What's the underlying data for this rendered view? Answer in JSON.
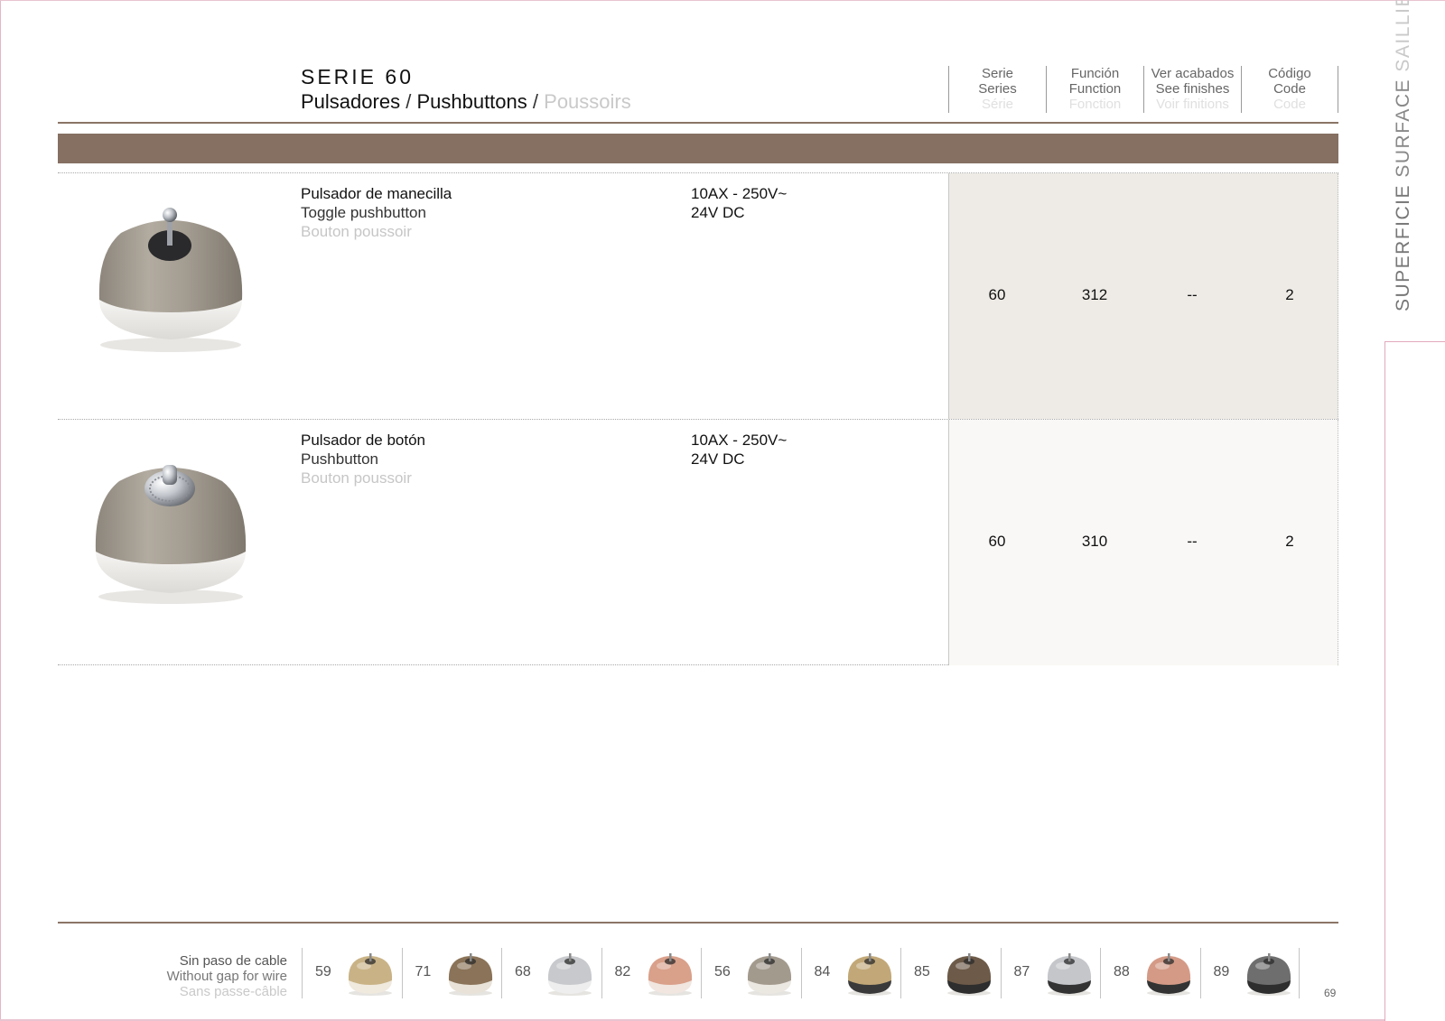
{
  "header": {
    "serie_title": "SERIE 60",
    "subtitle_es": "Pulsadores",
    "subtitle_en": "Pushbuttons",
    "subtitle_fr": "Poussoirs",
    "separator": "/",
    "columns": [
      {
        "es": "Serie",
        "en": "Series",
        "fr": "Série"
      },
      {
        "es": "Función",
        "en": "Function",
        "fr": "Fonction"
      },
      {
        "es": "Ver acabados",
        "en": "See finishes",
        "fr": "Voir finitions"
      },
      {
        "es": "Código",
        "en": "Code",
        "fr": "Code"
      }
    ]
  },
  "products": [
    {
      "name_es": "Pulsador de manecilla",
      "name_en": "Toggle pushbutton",
      "name_fr": "Bouton poussoir",
      "spec_1": "10AX - 250V~",
      "spec_2": "24V DC",
      "serie": "60",
      "function": "312",
      "finishes": "--",
      "code": "2",
      "image": "toggle-pushbutton-image"
    },
    {
      "name_es": "Pulsador de botón",
      "name_en": "Pushbutton",
      "name_fr": "Bouton poussoir",
      "spec_1": "10AX - 250V~",
      "spec_2": "24V DC",
      "serie": "60",
      "function": "310",
      "finishes": "--",
      "code": "2",
      "image": "pushbutton-image"
    }
  ],
  "side_tab": {
    "es": "SUPERFICIE",
    "en": "SURFACE",
    "fr": "SAILLIE"
  },
  "footer": {
    "label_es": "Sin paso de cable",
    "label_en": "Without gap for wire",
    "label_fr": "Sans passe-câble",
    "finishes": [
      {
        "code": "59",
        "top": "#c9b386",
        "base": "#efe9de",
        "color_name": "brass"
      },
      {
        "code": "71",
        "top": "#8a7358",
        "base": "#e8e2d8",
        "color_name": "old-bronze"
      },
      {
        "code": "68",
        "top": "#c7c9cc",
        "base": "#eeeeee",
        "color_name": "chrome"
      },
      {
        "code": "82",
        "top": "#d9a08a",
        "base": "#f1e6e0",
        "color_name": "copper"
      },
      {
        "code": "56",
        "top": "#a39a8e",
        "base": "#ebe7e1",
        "color_name": "satin-nickel"
      },
      {
        "code": "84",
        "top": "#c2a878",
        "base": "#3a3a3a",
        "color_name": "brass-black"
      },
      {
        "code": "85",
        "top": "#6d5a48",
        "base": "#2e2e2e",
        "color_name": "bronze-black"
      },
      {
        "code": "87",
        "top": "#c4c6ca",
        "base": "#333333",
        "color_name": "chrome-black"
      },
      {
        "code": "88",
        "top": "#d49a86",
        "base": "#333333",
        "color_name": "copper-black"
      },
      {
        "code": "89",
        "top": "#6e6e6e",
        "base": "#2e2e2e",
        "color_name": "graphite-black"
      }
    ]
  },
  "page_number": "69",
  "colors": {
    "accent_band": "#857062",
    "row1_shade": "#eeebe6",
    "row2_shade": "#f9f8f6"
  }
}
